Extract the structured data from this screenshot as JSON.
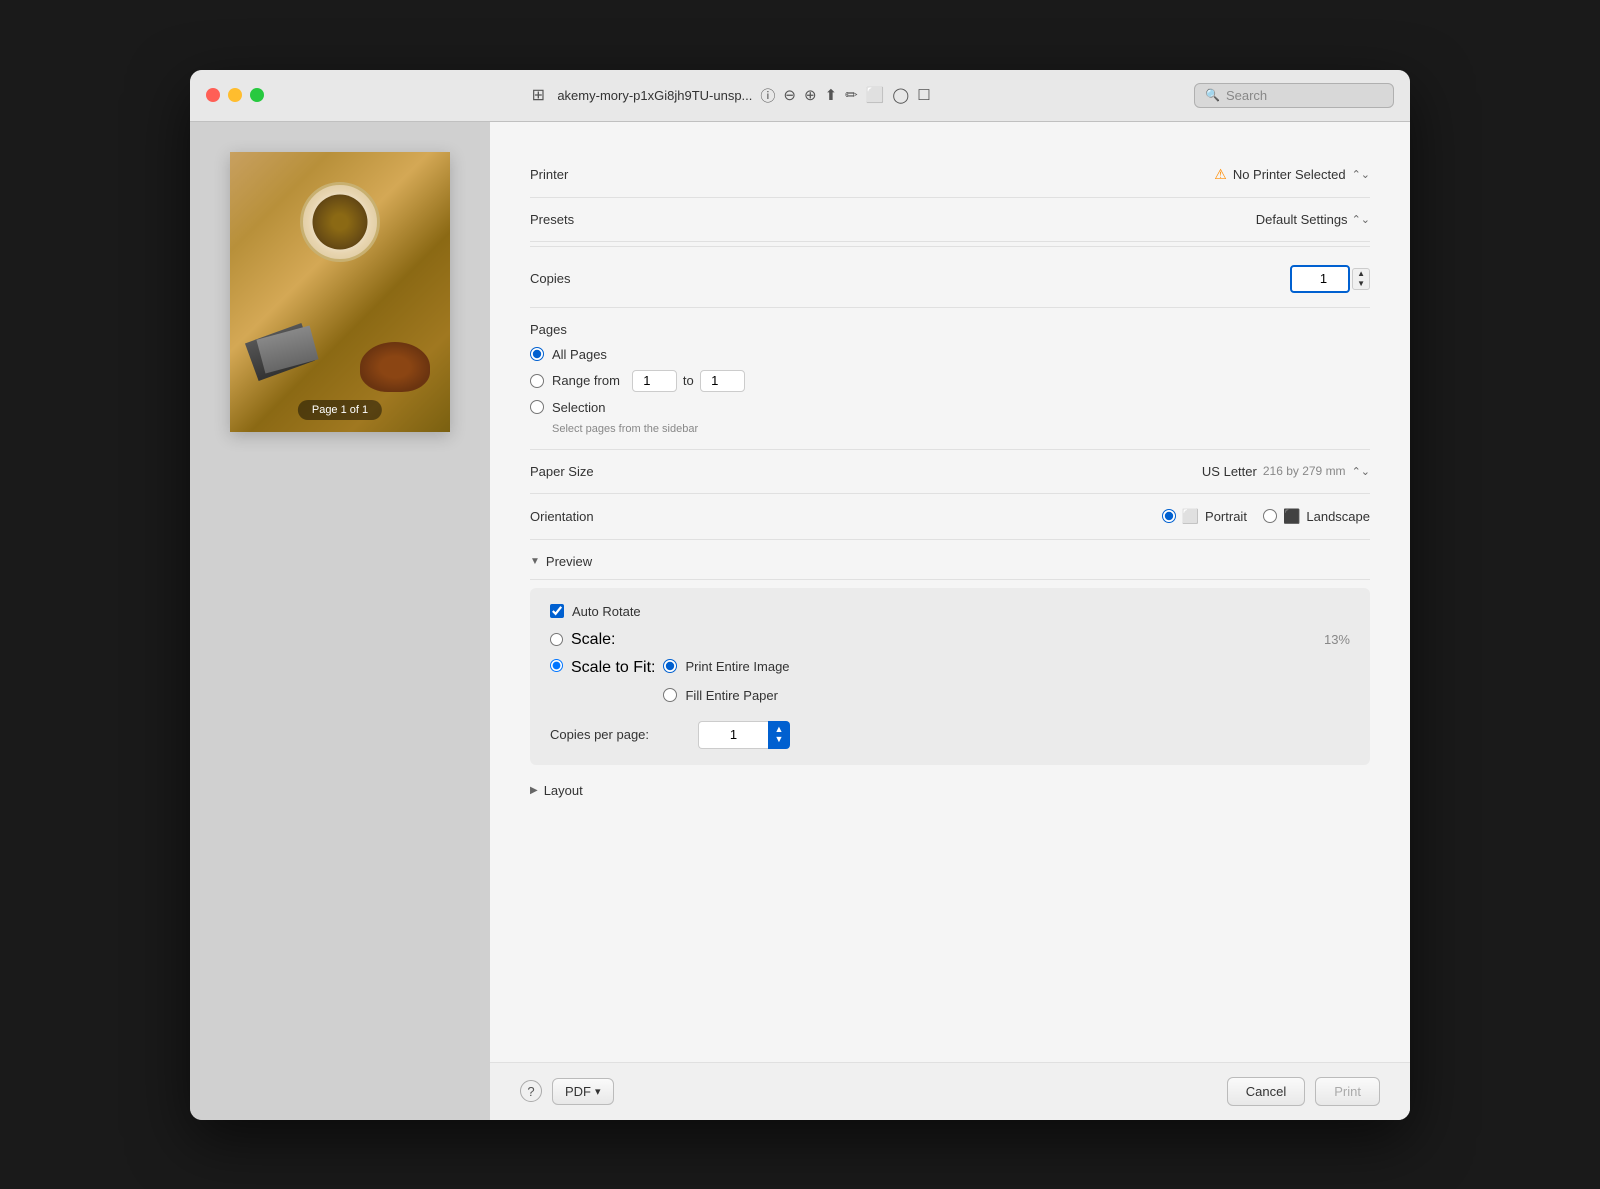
{
  "window": {
    "title": "akemy-mory-p1xGi8jh9TU-unsp...",
    "search_placeholder": "Search"
  },
  "preview": {
    "page_label": "Page 1 of 1"
  },
  "print": {
    "printer_label": "Printer",
    "printer_value": "No Printer Selected",
    "presets_label": "Presets",
    "presets_value": "Default Settings",
    "copies_label": "Copies",
    "copies_value": "1",
    "pages_label": "Pages",
    "all_pages_label": "All Pages",
    "range_from_label": "Range from",
    "range_from_value": "1",
    "range_to_label": "to",
    "range_to_value": "1",
    "selection_label": "Selection",
    "selection_hint": "Select pages from the sidebar",
    "paper_size_label": "Paper Size",
    "paper_size_value": "US Letter",
    "paper_size_sub": "216 by 279 mm",
    "orientation_label": "Orientation",
    "portrait_label": "Portrait",
    "landscape_label": "Landscape",
    "preview_section_label": "Preview",
    "auto_rotate_label": "Auto Rotate",
    "scale_label": "Scale:",
    "scale_value": "13%",
    "scale_to_fit_label": "Scale to Fit:",
    "print_entire_image_label": "Print Entire Image",
    "fill_entire_paper_label": "Fill Entire Paper",
    "copies_per_page_label": "Copies per page:",
    "copies_per_page_value": "1",
    "layout_section_label": "Layout",
    "pdf_label": "PDF",
    "cancel_label": "Cancel",
    "print_label": "Print",
    "help_label": "?"
  }
}
